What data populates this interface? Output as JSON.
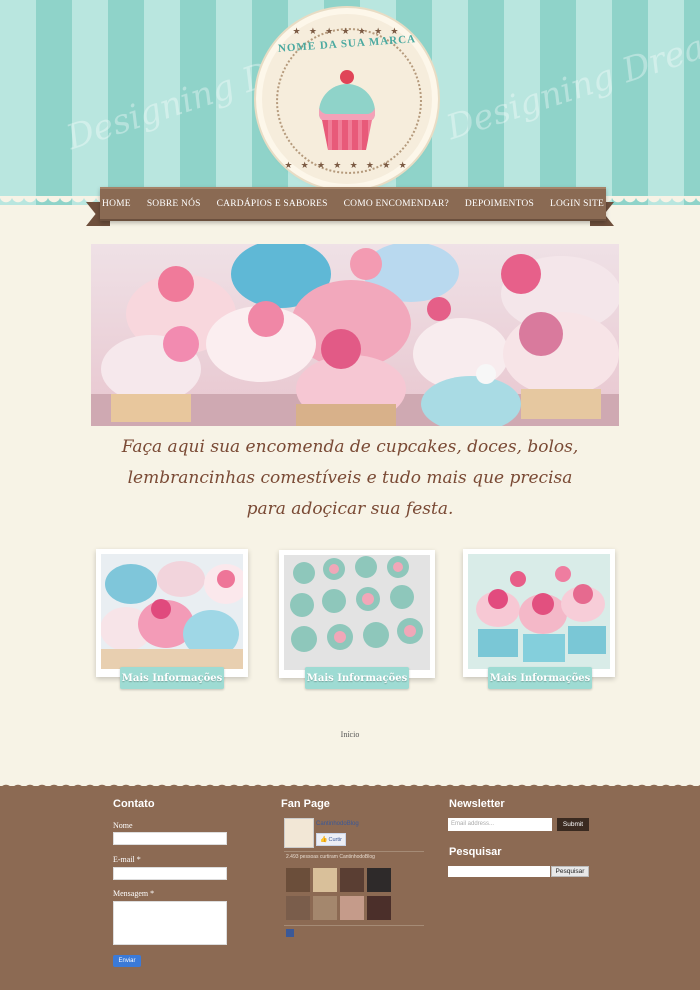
{
  "logo": {
    "brand_text": "NOME DA SUA MARCA"
  },
  "watermark": {
    "text": "Designing Dreams"
  },
  "nav": {
    "items": [
      "HOME",
      "SOBRE NÓS",
      "CARDÁPIOS E SABORES",
      "COMO ENCOMENDAR?",
      "DEPOIMENTOS",
      "LOGIN SITE"
    ]
  },
  "tagline": {
    "line1": "Faça aqui sua encomenda de cupcakes, doces, bolos,",
    "line2": "lembrancinhas comestíveis e tudo mais que precisa",
    "line3": "para adoçicar sua festa."
  },
  "cards": [
    {
      "button": "Mais Informações"
    },
    {
      "button": "Mais Informações"
    },
    {
      "button": "Mais Informações"
    }
  ],
  "breadcrumb": {
    "label": "Início"
  },
  "footer": {
    "contact": {
      "title": "Contato",
      "name_label": "Nome",
      "email_label": "E-mail *",
      "message_label": "Mensagem *",
      "send_label": "Enviar"
    },
    "fanpage": {
      "title": "Fan Page",
      "page_name": "CantinhodoBlog",
      "like_label": "Curtir",
      "count_text": "2.493 pessoas curtiram CantinhodoBlog"
    },
    "newsletter": {
      "title": "Newsletter",
      "placeholder": "Email address...",
      "submit_label": "Submit"
    },
    "search": {
      "title": "Pesquisar",
      "button_label": "Pesquisar"
    }
  },
  "colors": {
    "stripe_light": "#b9e6df",
    "stripe_dark": "#8fd3c9",
    "nav_brown": "#8a6a53",
    "footer_brown": "#8c6a53",
    "page_bg": "#f7f3e6",
    "accent_teal": "#9edbd3"
  }
}
